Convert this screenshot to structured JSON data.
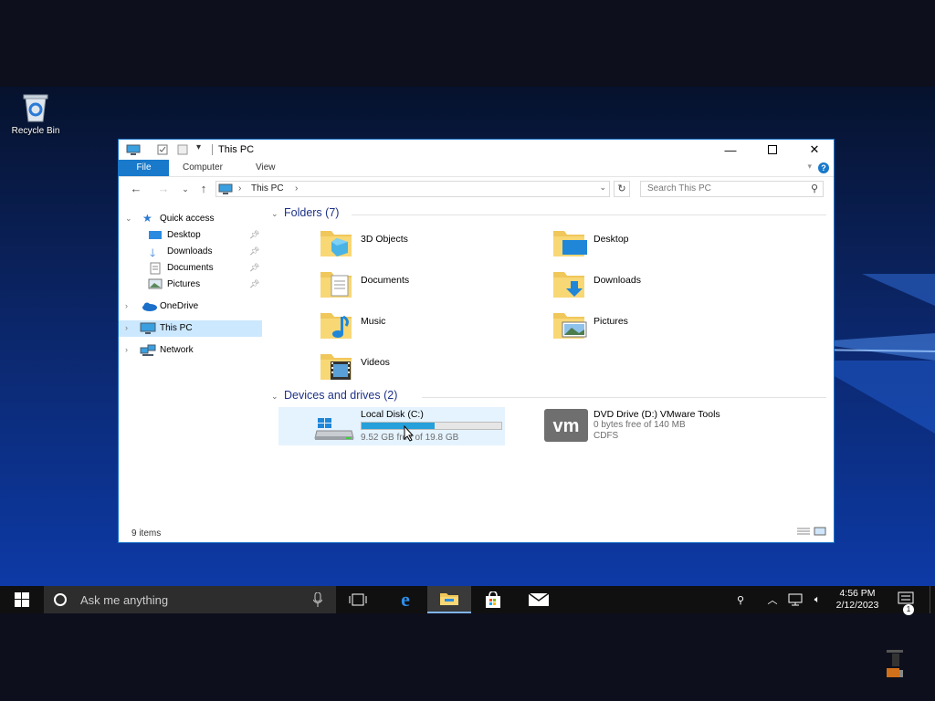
{
  "desktop": {
    "recycle_bin_label": "Recycle Bin"
  },
  "window": {
    "title": "This PC",
    "ribbon_tabs": [
      "File",
      "Computer",
      "View"
    ],
    "help_label": "?",
    "address_crumbs": [
      "This PC"
    ],
    "search_placeholder": "Search This PC",
    "status_text": "9 items"
  },
  "nav": {
    "quick_access": "Quick access",
    "pinned": [
      {
        "label": "Desktop",
        "icon": "desktop-icon"
      },
      {
        "label": "Downloads",
        "icon": "download-arrow-icon"
      },
      {
        "label": "Documents",
        "icon": "document-icon"
      },
      {
        "label": "Pictures",
        "icon": "picture-icon"
      }
    ],
    "onedrive": "OneDrive",
    "this_pc": "This PC",
    "network": "Network"
  },
  "folders": {
    "header": "Folders (7)",
    "items": [
      {
        "label": "3D Objects",
        "icon": "3d-objects-folder-icon"
      },
      {
        "label": "Desktop",
        "icon": "desktop-folder-icon"
      },
      {
        "label": "Documents",
        "icon": "documents-folder-icon"
      },
      {
        "label": "Downloads",
        "icon": "downloads-folder-icon"
      },
      {
        "label": "Music",
        "icon": "music-folder-icon"
      },
      {
        "label": "Pictures",
        "icon": "pictures-folder-icon"
      },
      {
        "label": "Videos",
        "icon": "videos-folder-icon"
      }
    ]
  },
  "drives": {
    "header": "Devices and drives (2)",
    "items": [
      {
        "name": "Local Disk (C:)",
        "detail": "9.52 GB free of 19.8 GB",
        "used_fraction": 0.52,
        "icon": "windows-drive-icon"
      },
      {
        "name": "DVD Drive (D:) VMware Tools",
        "detail": "0 bytes free of 140 MB",
        "fs": "CDFS",
        "icon": "vmware-logo-icon"
      }
    ]
  },
  "taskbar": {
    "search_text": "Ask me anything",
    "time": "4:56 PM",
    "date": "2/12/2023",
    "notification_count": "1"
  },
  "colors": {
    "accent": "#1979ca",
    "selection": "#cce8ff",
    "group_header": "#1e3287",
    "progress": "#26a0da"
  }
}
